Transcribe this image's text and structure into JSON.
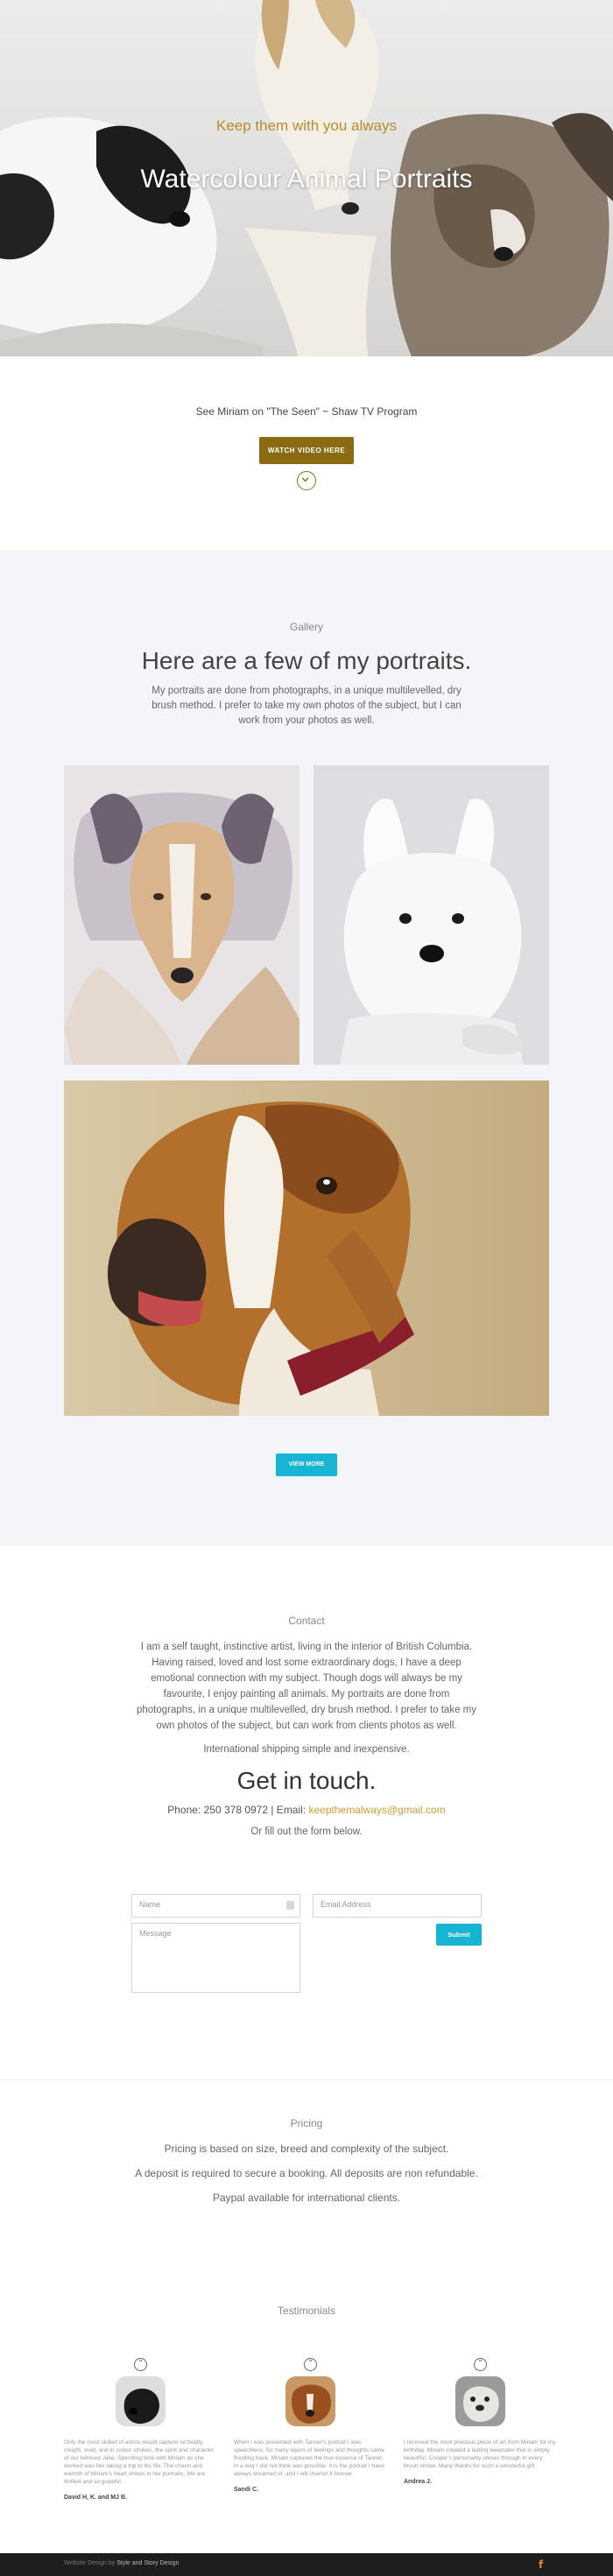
{
  "hero": {
    "kicker": "Keep them with you always",
    "title": "Watercolour Animal Portraits"
  },
  "video": {
    "line": "See Miriam on \"The Seen\" ~ Shaw TV Program",
    "button": "WATCH VIDEO HERE",
    "scroll_icon": "chevron-down-circle-icon"
  },
  "gallery": {
    "label": "Gallery",
    "heading": "Here are a few of my portraits.",
    "description": "My portraits are done from photographs, in a unique multilevelled, dry brush method. I prefer to take my own photos of the subject, but I can work from your photos as well.",
    "view_more": "VIEW MORE"
  },
  "contact": {
    "label": "Contact",
    "about": "I am a self taught, instinctive artist, living in the interior of British Columbia. Having raised, loved and lost some extraordinary dogs, I have a deep emotional connection with my subject. Though dogs will always be my favourite, I enjoy painting all animals. My portraits are done from photographs, in a unique multilevelled, dry brush method. I prefer to take my own photos of the subject, but can work from clients photos as well.",
    "shipping": "International shipping simple and inexpensive.",
    "heading": "Get in touch.",
    "phone_text": "Phone: 250 378 0972  |  Email: ",
    "email": "keepthemalways@gmail.com",
    "or_fill": "Or fill out the form below.",
    "form": {
      "name_placeholder": "Name",
      "email_placeholder": "Email Address",
      "message_placeholder": "Message",
      "submit": "Submit"
    }
  },
  "pricing": {
    "label": "Pricing",
    "line1": "Pricing is based on size, breed and complexity of the subject.",
    "line2": "A deposit is required to secure a booking.  All deposits are non refundable.",
    "line3": "Paypal available for international clients."
  },
  "testimonials": {
    "label": "Testimonials",
    "items": [
      {
        "text": "Only the most skilled of artists would capture so boldly, insight, vivid, and in colour strokes, the spirit and character of our beloved Jake. Spending time with Miriam as she worked was like taking a trip to his life. The charm and warmth of Miriam's heart shows in her portraits. We are thrilled and so grateful.",
        "author": "David H, K. and MJ B."
      },
      {
        "text": "When I was presented with Tanner's portrait I was speechless. So many layers of feelings and thoughts came flooding back. Miriam captured the true essence of Tanner in a way I did not think was possible. It is the portrait I have always dreamed of, and I will cherish it forever.",
        "author": "Sandi C."
      },
      {
        "text": "I received the most precious piece of art from Miriam for my birthday. Miriam created a lasting keepsake that is simply beautiful. Cooper's personality shines through in every brush stroke. Many thanks for such a wonderful gift.",
        "author": "Andrea J."
      }
    ]
  },
  "footer": {
    "credit_prefix": "Website Design by ",
    "credit_name": "Style and Story Design",
    "social_icon": "facebook-icon",
    "social_glyph": "f"
  },
  "colors": {
    "gold": "#8b6b12",
    "kicker": "#b88c2e",
    "teal": "#17b4d3",
    "email_link": "#d39b3a",
    "footer_bg": "#1e1e1e",
    "section_bg": "#f4f5f8"
  }
}
